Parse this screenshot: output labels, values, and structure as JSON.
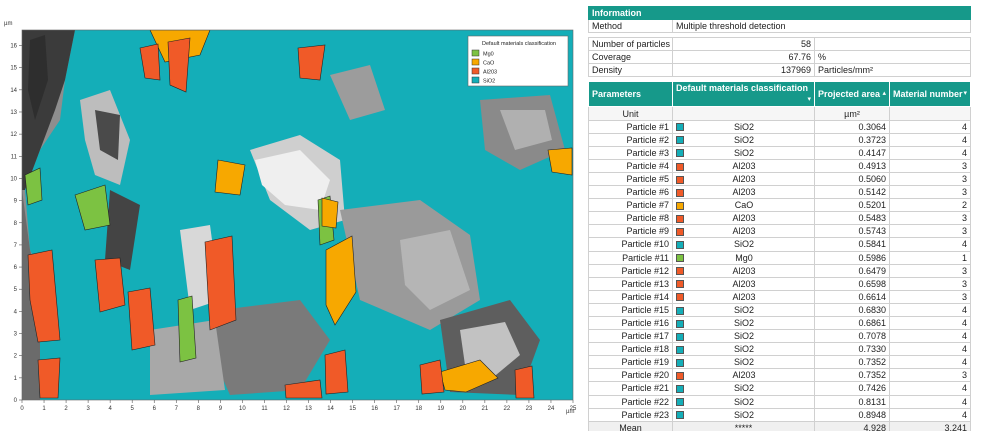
{
  "axes": {
    "unit": "µm",
    "x_ticks": [
      "0",
      "1",
      "2",
      "3",
      "4",
      "5",
      "6",
      "7",
      "8",
      "9",
      "10",
      "11",
      "12",
      "13",
      "14",
      "15",
      "16",
      "17",
      "18",
      "19",
      "20",
      "21",
      "22",
      "23",
      "24",
      "25"
    ],
    "y_ticks": [
      "0",
      "1",
      "2",
      "3",
      "4",
      "5",
      "6",
      "7",
      "8",
      "9",
      "10",
      "11",
      "12",
      "13",
      "14",
      "15",
      "16"
    ],
    "x_range": [
      0,
      25
    ],
    "y_range": [
      0,
      16.7
    ]
  },
  "legend": {
    "title": "Default materials classification",
    "items": [
      {
        "label": "Mg0",
        "color": "#7cc242"
      },
      {
        "label": "CaO",
        "color": "#f7a800"
      },
      {
        "label": "Al203",
        "color": "#f05a28"
      },
      {
        "label": "SiO2",
        "color": "#14aeb8"
      }
    ]
  },
  "information": {
    "title": "Information",
    "method_label": "Method",
    "method_value": "Multiple threshold detection"
  },
  "stats": [
    {
      "label": "Number of particles",
      "value": "58",
      "unit": ""
    },
    {
      "label": "Coverage",
      "value": "67.76",
      "unit": "%"
    },
    {
      "label": "Density",
      "value": "137969",
      "unit": "Particles/mm²"
    }
  ],
  "columns": {
    "parameters": "Parameters",
    "classification": "Default materials classification",
    "area": "Projected area",
    "material": "Material number"
  },
  "unit_row": {
    "label": "Unit",
    "area_unit": "µm²"
  },
  "colors": {
    "SiO2": "#14aeb8",
    "Al203": "#f05a28",
    "CaO": "#f7a800",
    "Mg0": "#7cc242",
    "header": "#16998a"
  },
  "particles": [
    {
      "name": "Particle #1",
      "material": "SiO2",
      "area": "0.3064",
      "number": "4"
    },
    {
      "name": "Particle #2",
      "material": "SiO2",
      "area": "0.3723",
      "number": "4"
    },
    {
      "name": "Particle #3",
      "material": "SiO2",
      "area": "0.4147",
      "number": "4"
    },
    {
      "name": "Particle #4",
      "material": "Al203",
      "area": "0.4913",
      "number": "3"
    },
    {
      "name": "Particle #5",
      "material": "Al203",
      "area": "0.5060",
      "number": "3"
    },
    {
      "name": "Particle #6",
      "material": "Al203",
      "area": "0.5142",
      "number": "3"
    },
    {
      "name": "Particle #7",
      "material": "CaO",
      "area": "0.5201",
      "number": "2"
    },
    {
      "name": "Particle #8",
      "material": "Al203",
      "area": "0.5483",
      "number": "3"
    },
    {
      "name": "Particle #9",
      "material": "Al203",
      "area": "0.5743",
      "number": "3"
    },
    {
      "name": "Particle #10",
      "material": "SiO2",
      "area": "0.5841",
      "number": "4"
    },
    {
      "name": "Particle #11",
      "material": "Mg0",
      "area": "0.5986",
      "number": "1"
    },
    {
      "name": "Particle #12",
      "material": "Al203",
      "area": "0.6479",
      "number": "3"
    },
    {
      "name": "Particle #13",
      "material": "Al203",
      "area": "0.6598",
      "number": "3"
    },
    {
      "name": "Particle #14",
      "material": "Al203",
      "area": "0.6614",
      "number": "3"
    },
    {
      "name": "Particle #15",
      "material": "SiO2",
      "area": "0.6830",
      "number": "4"
    },
    {
      "name": "Particle #16",
      "material": "SiO2",
      "area": "0.6861",
      "number": "4"
    },
    {
      "name": "Particle #17",
      "material": "SiO2",
      "area": "0.7078",
      "number": "4"
    },
    {
      "name": "Particle #18",
      "material": "SiO2",
      "area": "0.7330",
      "number": "4"
    },
    {
      "name": "Particle #19",
      "material": "SiO2",
      "area": "0.7352",
      "number": "4"
    },
    {
      "name": "Particle #20",
      "material": "Al203",
      "area": "0.7352",
      "number": "3"
    },
    {
      "name": "Particle #21",
      "material": "SiO2",
      "area": "0.7426",
      "number": "4"
    },
    {
      "name": "Particle #22",
      "material": "SiO2",
      "area": "0.8131",
      "number": "4"
    },
    {
      "name": "Particle #23",
      "material": "SiO2",
      "area": "0.8948",
      "number": "4"
    }
  ],
  "mean_row": {
    "label": "Mean",
    "classification": "*****",
    "area": "4.928",
    "material": "3.241"
  }
}
